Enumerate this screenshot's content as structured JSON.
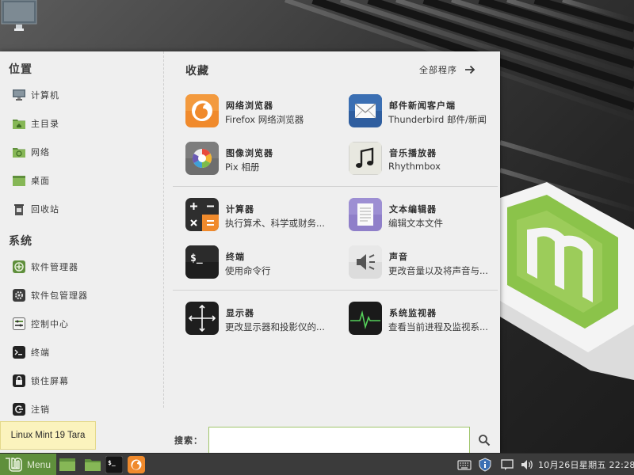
{
  "sidebar": {
    "places_title": "位置",
    "places": [
      {
        "label": "计算机",
        "icon": "computer-icon"
      },
      {
        "label": "主目录",
        "icon": "home-folder-icon"
      },
      {
        "label": "网络",
        "icon": "network-folder-icon"
      },
      {
        "label": "桌面",
        "icon": "desktop-folder-icon"
      },
      {
        "label": "回收站",
        "icon": "trash-icon"
      }
    ],
    "system_title": "系统",
    "system": [
      {
        "label": "软件管理器",
        "icon": "software-manager-icon"
      },
      {
        "label": "软件包管理器",
        "icon": "package-manager-icon"
      },
      {
        "label": "控制中心",
        "icon": "control-center-icon"
      },
      {
        "label": "终端",
        "icon": "terminal-icon"
      },
      {
        "label": "锁住屏幕",
        "icon": "lock-icon"
      },
      {
        "label": "注销",
        "icon": "logout-icon"
      }
    ]
  },
  "favorites": {
    "title": "收藏",
    "all_apps_label": "全部程序",
    "apps": [
      {
        "name": "网络浏览器",
        "desc": "Firefox 网络浏览器",
        "icon": "firefox-icon"
      },
      {
        "name": "邮件新闻客户端",
        "desc": "Thunderbird 邮件/新闻",
        "icon": "thunderbird-icon"
      },
      {
        "name": "图像浏览器",
        "desc": "Pix 相册",
        "icon": "pix-icon"
      },
      {
        "name": "音乐播放器",
        "desc": "Rhythmbox",
        "icon": "rhythmbox-icon"
      },
      {
        "name": "计算器",
        "desc": "执行算术、科学或财务...",
        "icon": "calculator-icon"
      },
      {
        "name": "文本编辑器",
        "desc": "编辑文本文件",
        "icon": "text-editor-icon"
      },
      {
        "name": "终端",
        "desc": "使用命令行",
        "icon": "terminal-app-icon"
      },
      {
        "name": "声音",
        "desc": "更改音量以及将声音与...",
        "icon": "sound-icon"
      },
      {
        "name": "显示器",
        "desc": "更改显示器和投影仪的...",
        "icon": "display-icon"
      },
      {
        "name": "系统监视器",
        "desc": "查看当前进程及监视系...",
        "icon": "system-monitor-icon"
      }
    ]
  },
  "search": {
    "label": "搜索：",
    "value": "",
    "placeholder": ""
  },
  "tooltip": {
    "text": "Linux Mint 19 Tara"
  },
  "panel": {
    "menu_label": "Menu",
    "clock": "10月26日星期五 22:28",
    "accent": "#8bc34a"
  }
}
